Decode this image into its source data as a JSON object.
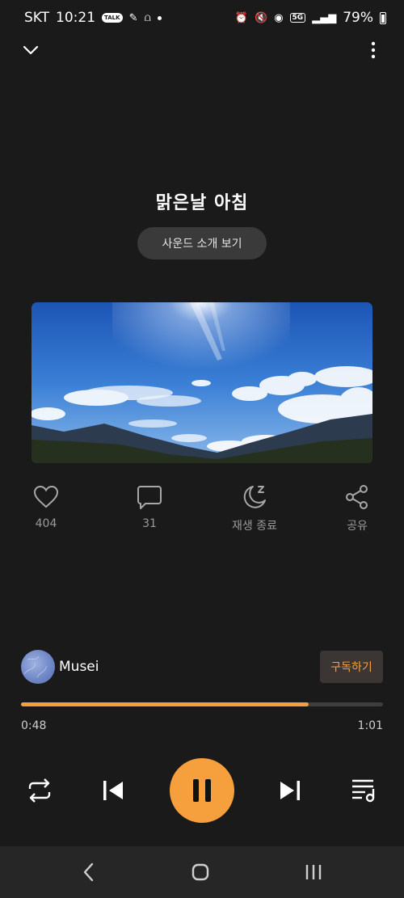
{
  "status_bar": {
    "carrier": "SKT",
    "time": "10:21",
    "talk_badge": "TALK",
    "network": "5G",
    "battery": "79%"
  },
  "track": {
    "title": "맑은날 아침",
    "intro_button": "사운드 소개 보기"
  },
  "actions": {
    "like_count": "404",
    "comment_count": "31",
    "sleep_timer_label": "재생 종료",
    "share_label": "공유"
  },
  "channel": {
    "name": "Musei",
    "subscribe_label": "구독하기"
  },
  "playback": {
    "current_time": "0:48",
    "total_time": "1:01",
    "progress": 0.795,
    "state": "playing"
  },
  "colors": {
    "accent": "#f5a03c",
    "background": "#1a1a1a",
    "muted_text": "#9a9a9a"
  },
  "icons": {
    "collapse": "chevron-down-icon",
    "more": "more-vertical-icon",
    "like": "heart-icon",
    "comment": "comment-icon",
    "sleep": "moon-sleep-icon",
    "share": "share-icon",
    "repeat": "repeat-icon",
    "previous": "skip-previous-icon",
    "pause": "pause-icon",
    "next": "skip-next-icon",
    "playlist": "playlist-icon"
  }
}
